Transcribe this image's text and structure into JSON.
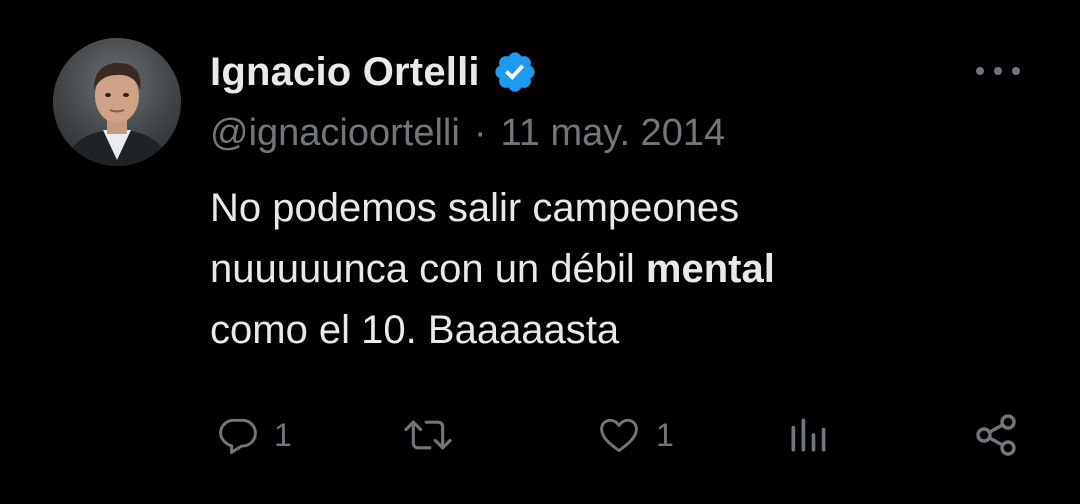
{
  "author": {
    "display_name": "Ignacio Ortelli",
    "handle": "@ignacioortelli",
    "verified": true,
    "avatar_icon": "profile-photo"
  },
  "meta": {
    "separator": "·",
    "date": "11 may. 2014"
  },
  "tweet": {
    "line1": "No podemos salir campeones",
    "line2_prefix": "nuuuuunca con un débil ",
    "line2_bold": "mental",
    "line3": "como el 10. Baaaaasta"
  },
  "actions": {
    "replies": "1",
    "retweets": "",
    "likes": "1",
    "views": ""
  },
  "colors": {
    "background": "#000000",
    "text": "#e7e9ea",
    "muted": "#71767b",
    "verified": "#1d9bf0"
  }
}
